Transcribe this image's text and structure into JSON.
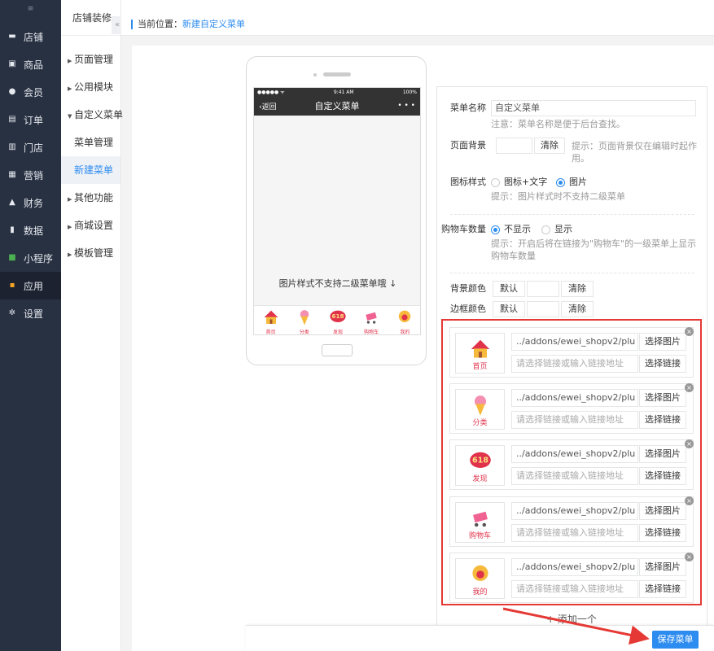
{
  "nav": {
    "collapse_icon": "≡",
    "items": [
      {
        "label": "店铺",
        "icon": "store-icon",
        "glyph": "▬"
      },
      {
        "label": "商品",
        "icon": "goods-icon",
        "glyph": "▣"
      },
      {
        "label": "会员",
        "icon": "user-icon",
        "glyph": "●"
      },
      {
        "label": "订单",
        "icon": "order-icon",
        "glyph": "▤"
      },
      {
        "label": "门店",
        "icon": "shop-icon",
        "glyph": "▥"
      },
      {
        "label": "营销",
        "icon": "gift-icon",
        "glyph": "▦"
      },
      {
        "label": "财务",
        "icon": "finance-icon",
        "glyph": "▲"
      },
      {
        "label": "数据",
        "icon": "chart-icon",
        "glyph": "▮"
      },
      {
        "label": "小程序",
        "icon": "miniprogram-icon",
        "glyph": "■"
      },
      {
        "label": "应用",
        "icon": "apps-icon",
        "glyph": "▪"
      },
      {
        "label": "设置",
        "icon": "gear-icon",
        "glyph": "✲"
      }
    ]
  },
  "submenu": {
    "title": "店铺装修",
    "collapse": "«",
    "items": [
      {
        "label": "页面管理",
        "type": "group"
      },
      {
        "label": "公用模块",
        "type": "group"
      },
      {
        "label": "自定义菜单",
        "type": "group-open"
      },
      {
        "label": "菜单管理",
        "type": "child"
      },
      {
        "label": "新建菜单",
        "type": "child-active"
      },
      {
        "label": "其他功能",
        "type": "group"
      },
      {
        "label": "商城设置",
        "type": "group"
      },
      {
        "label": "模板管理",
        "type": "group"
      }
    ]
  },
  "breadcrumb": {
    "prefix": "当前位置：",
    "current": "新建自定义菜单"
  },
  "phone": {
    "status_left": "●●●●● ᯤ",
    "status_time": "9:41 AM",
    "status_right": "100%",
    "back": "返回",
    "title": "自定义菜单",
    "more": "• • •",
    "notice": "图片样式不支持二级菜单哦",
    "tabs": [
      "首页",
      "分类",
      "发现",
      "购物车",
      "我的"
    ]
  },
  "form": {
    "menu_name_label": "菜单名称",
    "menu_name_value": "自定义菜单",
    "menu_name_help": "注意：菜单名称是便于后台查找。",
    "page_bg_label": "页面背景",
    "clear": "清除",
    "page_bg_help": "提示：页面背景仅在编辑时起作用。",
    "icon_style_label": "图标样式",
    "icon_style_options": [
      "图标+文字",
      "图片"
    ],
    "icon_style_help": "提示：图片样式时不支持二级菜单",
    "cart_label": "购物车数量",
    "cart_options": [
      "不显示",
      "显示"
    ],
    "cart_help": "提示：开启后将在链接为\"购物车\"的一级菜单上显示购物车数量",
    "bg_color_label": "背景颜色",
    "border_color_label": "边框颜色",
    "default": "默认"
  },
  "cards": [
    {
      "label": "首页",
      "url": "../addons/ewei_shopv2/plu",
      "link_placeholder": "请选择链接或输入链接地址"
    },
    {
      "label": "分类",
      "url": "../addons/ewei_shopv2/plu",
      "link_placeholder": "请选择链接或输入链接地址"
    },
    {
      "label": "发现",
      "url": "../addons/ewei_shopv2/plu",
      "link_placeholder": "请选择链接或输入链接地址"
    },
    {
      "label": "购物车",
      "url": "../addons/ewei_shopv2/plu",
      "link_placeholder": "请选择链接或输入链接地址"
    },
    {
      "label": "我的",
      "url": "../addons/ewei_shopv2/plu",
      "link_placeholder": "请选择链接或输入链接地址"
    }
  ],
  "card_buttons": {
    "pick_image": "选择图片",
    "pick_link": "选择链接",
    "delete": "×"
  },
  "add_more": "+ 添加一个",
  "save": "保存菜单",
  "colors": {
    "accent": "#2d8cf0",
    "highlight": "#e53935",
    "nav_bg": "#283142"
  }
}
